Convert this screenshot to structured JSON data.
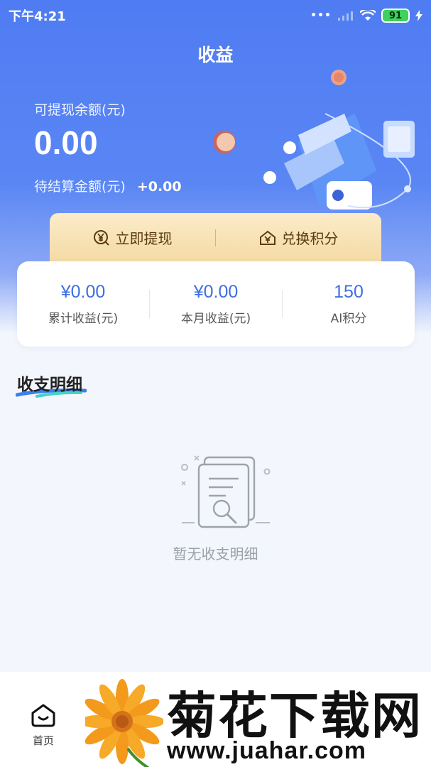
{
  "status_bar": {
    "time": "下午4:21",
    "signal_dots": "•••",
    "battery": "91"
  },
  "header": {
    "title": "收益"
  },
  "balance": {
    "label": "可提现余额(元)",
    "value": "0.00",
    "pending_label": "待结算金额(元)",
    "pending_value": "+0.00"
  },
  "actions": {
    "withdraw_label": "立即提现",
    "exchange_label": "兑换积分"
  },
  "stats": [
    {
      "value": "¥0.00",
      "label": "累计收益(元)"
    },
    {
      "value": "¥0.00",
      "label": "本月收益(元)"
    },
    {
      "value": "150",
      "label": "AI积分"
    }
  ],
  "details": {
    "title": "收支明细",
    "empty_text": "暂无收支明细"
  },
  "nav": {
    "home_label": "首页"
  },
  "watermark": {
    "title": "菊花下载网",
    "url": "www.juahar.com"
  },
  "colors": {
    "hero_blue": "#4f7cf2",
    "stat_blue": "#3d6fe3",
    "gold_bar": "#f4d9a3"
  }
}
